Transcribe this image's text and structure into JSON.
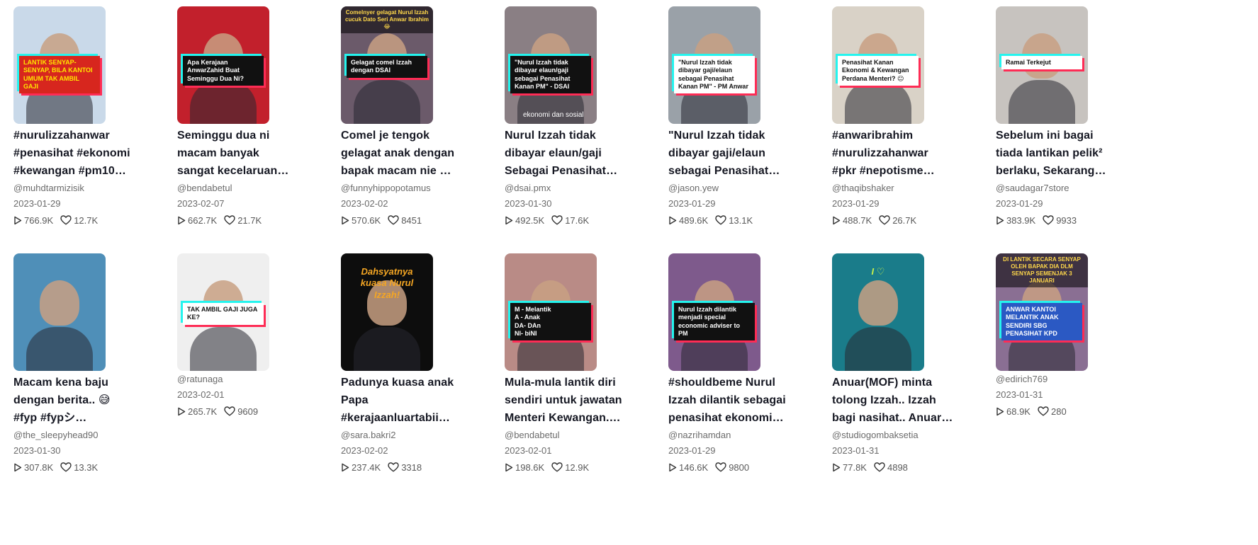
{
  "videos": [
    {
      "caption": "#nurulizzahanwar\n#penasihat #ekonomi\n#kewangan #pm10…",
      "user": "@muhdtarmizisik",
      "date": "2023-01-29",
      "views": "766.9K",
      "likes": "12.7K",
      "thumb": {
        "bg": "#c9d9e9",
        "overlay": "LANTIK SENYAP-SENYAP, BILA KANTOI UMUM TAK AMBIL GAJI",
        "overlay_bg": "#d7261e",
        "overlay_color": "#ffe600"
      }
    },
    {
      "caption": "Seminggu dua ni\nmacam banyak\nsangat kecelaruan…",
      "user": "@bendabetul",
      "date": "2023-02-07",
      "views": "662.7K",
      "likes": "21.7K",
      "thumb": {
        "bg": "#c2202c",
        "overlay": "Apa Kerajaan AnwarZahid Buat Seminggu Dua Ni?",
        "overlay_bg": "#111111",
        "overlay_color": "#ffffff"
      }
    },
    {
      "caption": "Comel je tengok\ngelagat anak dengan\nbapak macam nie …",
      "user": "@funnyhippopotamus",
      "date": "2023-02-02",
      "views": "570.6K",
      "likes": "8451",
      "thumb": {
        "bg": "#6b5a6a",
        "overlay": "Gelagat comel Izzah dengan DSAI",
        "overlay_bg": "#111111",
        "overlay_color": "#ffffff",
        "top_text": "Comelnyer gelagat Nurul Izzah cucuk Dato Seri Anwar Ibrahim 😂"
      }
    },
    {
      "caption": "Nurul Izzah tidak\ndibayar elaun/gaji\nSebagai Penasihat…",
      "user": "@dsai.pmx",
      "date": "2023-01-30",
      "views": "492.5K",
      "likes": "17.6K",
      "thumb": {
        "bg": "#8a7f84",
        "overlay": "\"Nurul Izzah tidak dibayar elaun/gaji sebagai Penasihat Kanan PM\" - DSAI",
        "overlay_bg": "#111111",
        "overlay_color": "#ffffff",
        "bottom_text": "ekonomi dan sosial"
      }
    },
    {
      "caption": "\"Nurul Izzah tidak\ndibayar gaji/elaun\nsebagai Penasihat…",
      "user": "@jason.yew",
      "date": "2023-01-29",
      "views": "489.6K",
      "likes": "13.1K",
      "thumb": {
        "bg": "#9aa1a8",
        "overlay": "\"Nurul Izzah tidak dibayar gaji/elaun sebagai Penasihat Kanan PM\" - PM Anwar",
        "overlay_bg": "#ffffff",
        "overlay_color": "#111111"
      }
    },
    {
      "caption": "#anwaribrahim\n#nurulizzahanwar\n#pkr #nepotisme…",
      "user": "@thaqibshaker",
      "date": "2023-01-29",
      "views": "488.7K",
      "likes": "26.7K",
      "thumb": {
        "bg": "#d9d2c7",
        "overlay": "Penasihat Kanan Ekonomi & Kewangan Perdana Menteri? 😐",
        "overlay_bg": "#ffffff",
        "overlay_color": "#111111"
      }
    },
    {
      "caption": "Sebelum ini bagai\ntiada lantikan pelik²\nberlaku, Sekarang…",
      "user": "@saudagar7store",
      "date": "2023-01-29",
      "views": "383.9K",
      "likes": "9933",
      "thumb": {
        "bg": "#c7c3bf",
        "overlay": "Ramai Terkejut",
        "overlay_bg": "#ffffff",
        "overlay_color": "#111111"
      }
    },
    {
      "caption": "Macam kena baju\ndengan berita.. 😅\n#fyp #fypシ…",
      "user": "@the_sleepyhead90",
      "date": "2023-01-30",
      "views": "307.8K",
      "likes": "13.3K",
      "thumb": {
        "bg": "#4f8fb8",
        "overlay": "",
        "overlay_bg": "#000000",
        "overlay_color": "#ffffff"
      }
    },
    {
      "caption": "",
      "user": "@ratunaga",
      "date": "2023-02-01",
      "views": "265.7K",
      "likes": "9609",
      "thumb": {
        "bg": "#efefef",
        "overlay": "TAK AMBIL GAJI JUGA KE?",
        "overlay_bg": "#ffffff",
        "overlay_color": "#111111"
      }
    },
    {
      "caption": "Padunya kuasa anak\nPapa\n#kerajaanluartabii…",
      "user": "@sara.bakri2",
      "date": "2023-02-02",
      "views": "237.4K",
      "likes": "3318",
      "thumb": {
        "bg": "#0d0d0d",
        "overlay": "Dahsyatnya kuasa Nurul Izzah!",
        "overlay_bg": "transparent",
        "overlay_color": "#f5a623"
      }
    },
    {
      "caption": "Mula-mula lantik diri\nsendiri untuk jawatan\nMenteri Kewangan.…",
      "user": "@bendabetul",
      "date": "2023-02-01",
      "views": "198.6K",
      "likes": "12.9K",
      "thumb": {
        "bg": "#b98b86",
        "overlay": "M - Melantik\nA - Anak\nDA- DAn\nNI- biNI",
        "overlay_bg": "#111111",
        "overlay_color": "#ffffff"
      }
    },
    {
      "caption": "#shouldbeme Nurul\nIzzah dilantik sebagai\npenasihat ekonomi…",
      "user": "@nazrihamdan",
      "date": "2023-01-29",
      "views": "146.6K",
      "likes": "9800",
      "thumb": {
        "bg": "#7e5a8c",
        "overlay": "Nurul Izzah dilantik menjadi special economic adviser to PM",
        "overlay_bg": "#111111",
        "overlay_color": "#ffffff"
      }
    },
    {
      "caption": "Anuar(MOF) minta\ntolong Izzah.. Izzah\nbagi nasihat.. Anuar…",
      "user": "@studiogombaksetia",
      "date": "2023-01-31",
      "views": "77.8K",
      "likes": "4898",
      "thumb": {
        "bg": "#1a7c8a",
        "overlay": "I ♡",
        "overlay_bg": "transparent",
        "overlay_color": "#c8f04a"
      }
    },
    {
      "caption": "",
      "user": "@edirich769",
      "date": "2023-01-31",
      "views": "68.9K",
      "likes": "280",
      "thumb": {
        "bg": "#8a6f93",
        "overlay": "ANWAR KANTOI MELANTIK ANAK SENDIRI SBG PENASIHAT KPD",
        "overlay_bg": "#2b59c3",
        "overlay_color": "#ffffff",
        "top_text": "DI LANTIK SECARA SENYAP OLEH BAPAK DIA DLM SENYAP SEMENJAK 3 JANUARI"
      }
    }
  ]
}
